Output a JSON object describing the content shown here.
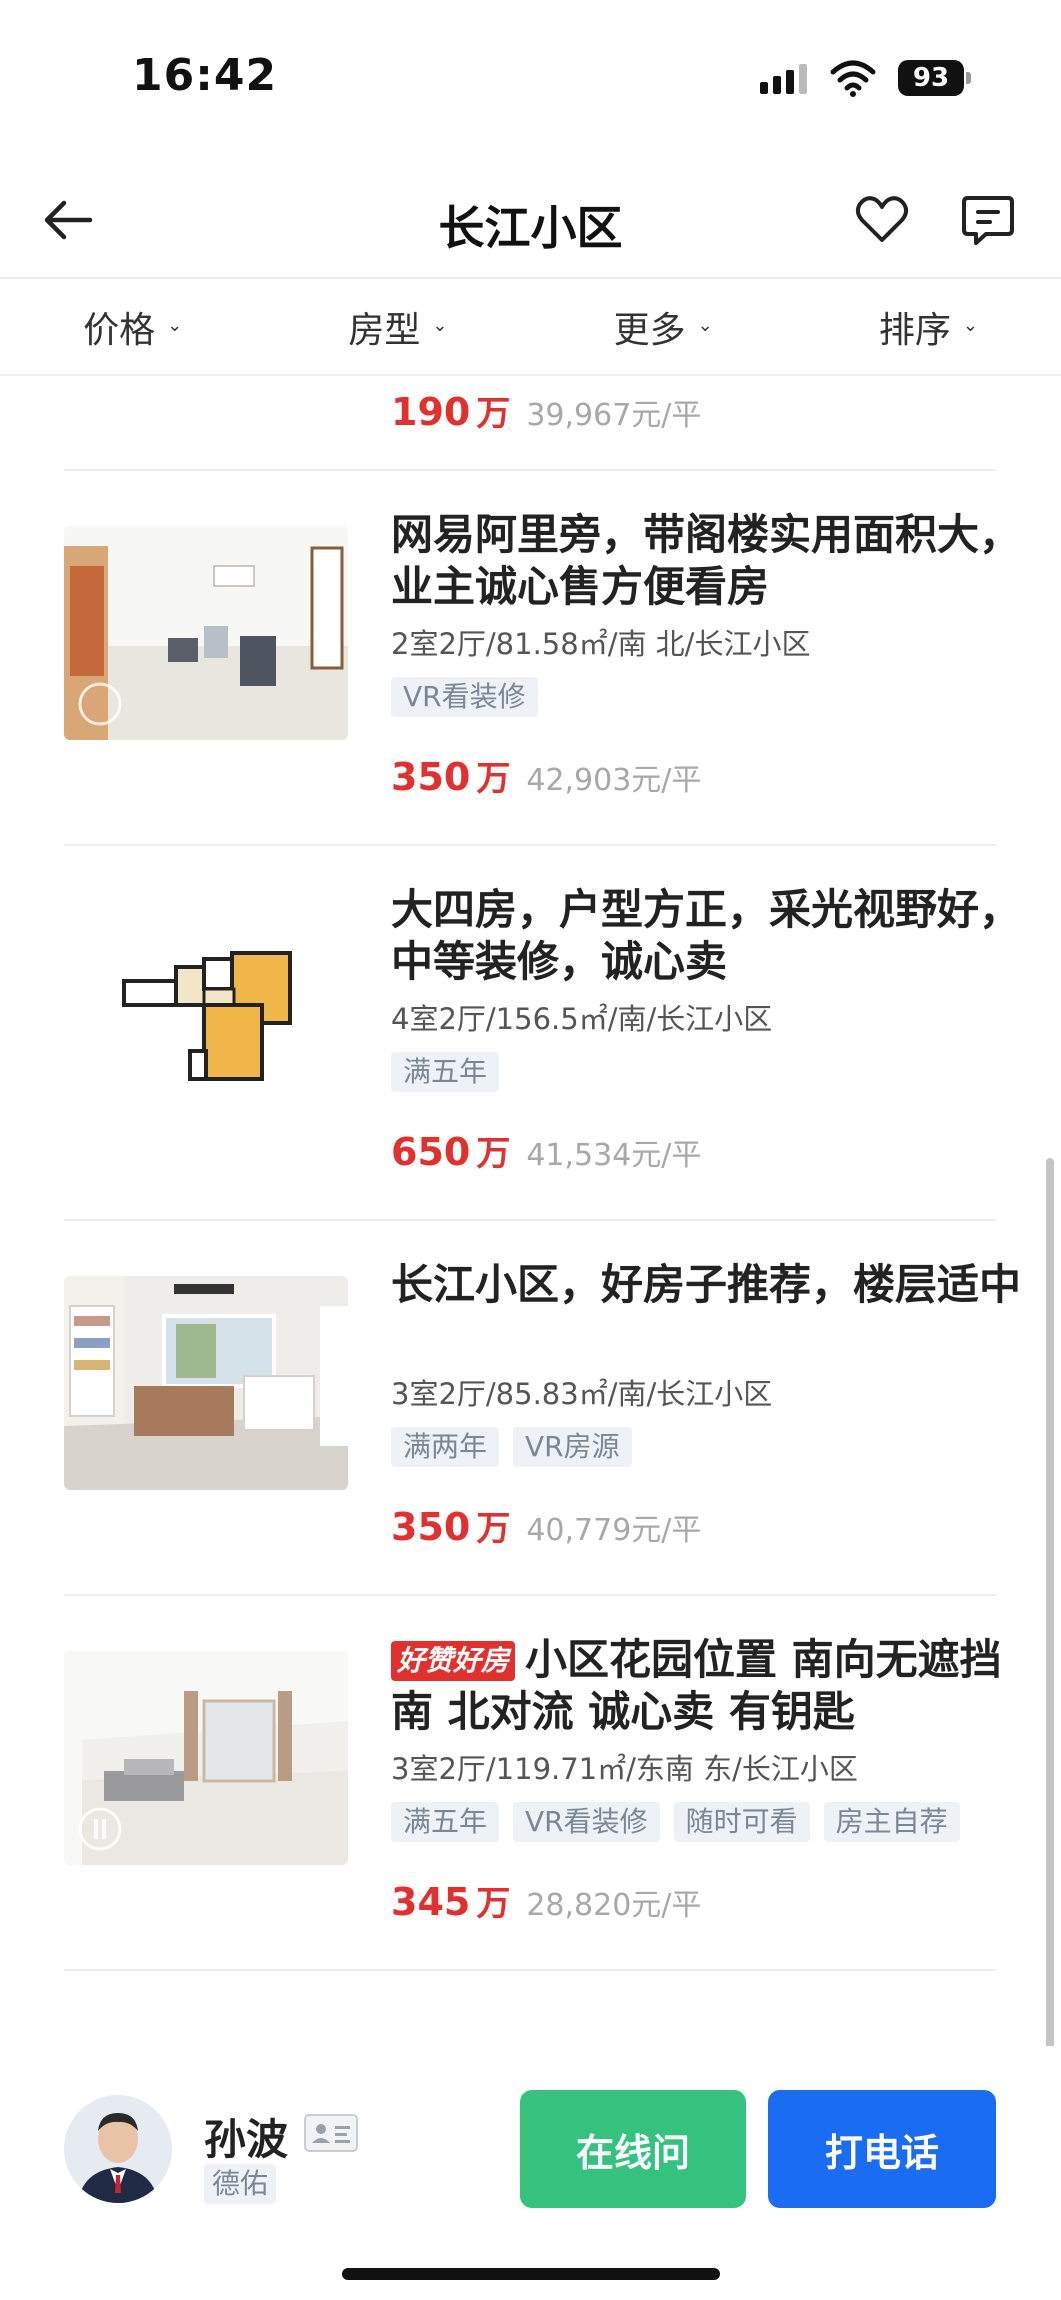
{
  "status_bar": {
    "time": "16:42",
    "battery": "93"
  },
  "nav": {
    "title": "长江小区",
    "back_icon": "back-arrow-icon",
    "favorite_icon": "heart-icon",
    "message_icon": "chat-icon"
  },
  "filters": [
    {
      "label": "价格"
    },
    {
      "label": "房型"
    },
    {
      "label": "更多"
    },
    {
      "label": "排序"
    }
  ],
  "partial_listing": {
    "price": "190",
    "price_unit": "万",
    "unit_price": "39,967元/平"
  },
  "listings": [
    {
      "badge": "",
      "title": "网易阿里旁，带阁楼实用面积大，业主诚心售方便看房",
      "meta": "2室2厅/81.58㎡/南 北/长江小区",
      "tags": [
        "VR看装修"
      ],
      "price": "350",
      "price_unit": "万",
      "unit_price": "42,903元/平",
      "thumb": "room-photo"
    },
    {
      "badge": "",
      "title": "大四房，户型方正，采光视野好，中等装修，诚心卖",
      "meta": "4室2厅/156.5㎡/南/长江小区",
      "tags": [
        "满五年"
      ],
      "price": "650",
      "price_unit": "万",
      "unit_price": "41,534元/平",
      "thumb": "floorplan"
    },
    {
      "badge": "",
      "title": "长江小区，好房子推荐，楼层适中",
      "meta": "3室2厅/85.83㎡/南/长江小区",
      "tags": [
        "满两年",
        "VR房源"
      ],
      "price": "350",
      "price_unit": "万",
      "unit_price": "40,779元/平",
      "thumb": "room-photo"
    },
    {
      "badge": "好赞好房",
      "title": "小区花园位置 南向无遮挡南 北对流 诚心卖 有钥匙",
      "meta": "3室2厅/119.71㎡/东南 东/长江小区",
      "tags": [
        "满五年",
        "VR看装修",
        "随时可看",
        "房主自荐"
      ],
      "price": "345",
      "price_unit": "万",
      "unit_price": "28,820元/平",
      "thumb": "room-photo"
    }
  ],
  "agent": {
    "name": "孙波",
    "company": "德佑",
    "online_button": "在线问",
    "call_button": "打电话"
  },
  "colors": {
    "price": "#e0312f",
    "online": "#34c27e",
    "call": "#1a6cf2"
  }
}
